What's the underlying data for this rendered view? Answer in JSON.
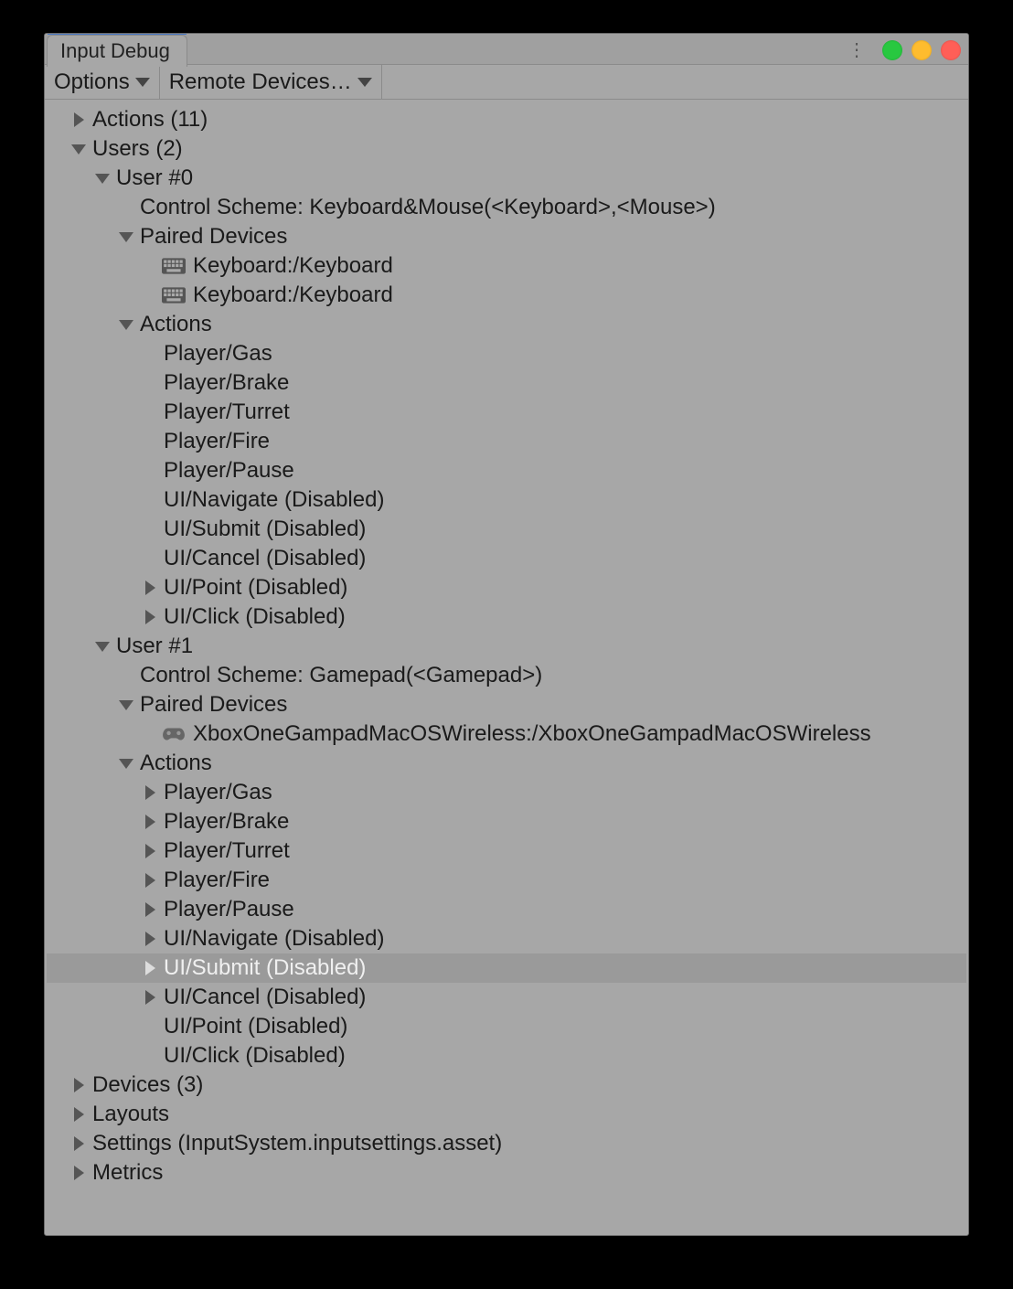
{
  "tab_title": "Input Debug",
  "toolbar": {
    "options_label": "Options",
    "remote_label": "Remote Devices…"
  },
  "tree": {
    "actions": {
      "label": "Actions (11)"
    },
    "users": {
      "label": "Users (2)",
      "user0": {
        "label": "User #0",
        "scheme": "Control Scheme: Keyboard&Mouse(<Keyboard>,<Mouse>)",
        "paired_label": "Paired Devices",
        "devices": [
          "Keyboard:/Keyboard",
          "Keyboard:/Keyboard"
        ],
        "actions_label": "Actions",
        "actions": [
          {
            "label": "Player/Gas",
            "fold": "none"
          },
          {
            "label": "Player/Brake",
            "fold": "none"
          },
          {
            "label": "Player/Turret",
            "fold": "none"
          },
          {
            "label": "Player/Fire",
            "fold": "none"
          },
          {
            "label": "Player/Pause",
            "fold": "none"
          },
          {
            "label": "UI/Navigate (Disabled)",
            "fold": "none"
          },
          {
            "label": "UI/Submit (Disabled)",
            "fold": "none"
          },
          {
            "label": "UI/Cancel (Disabled)",
            "fold": "none"
          },
          {
            "label": "UI/Point (Disabled)",
            "fold": "right"
          },
          {
            "label": "UI/Click (Disabled)",
            "fold": "right"
          }
        ]
      },
      "user1": {
        "label": "User #1",
        "scheme": "Control Scheme: Gamepad(<Gamepad>)",
        "paired_label": "Paired Devices",
        "devices": [
          "XboxOneGampadMacOSWireless:/XboxOneGampadMacOSWireless"
        ],
        "actions_label": "Actions",
        "actions": [
          {
            "label": "Player/Gas",
            "fold": "right"
          },
          {
            "label": "Player/Brake",
            "fold": "right"
          },
          {
            "label": "Player/Turret",
            "fold": "right"
          },
          {
            "label": "Player/Fire",
            "fold": "right"
          },
          {
            "label": "Player/Pause",
            "fold": "right"
          },
          {
            "label": "UI/Navigate (Disabled)",
            "fold": "right"
          },
          {
            "label": "UI/Submit (Disabled)",
            "fold": "right",
            "selected": true
          },
          {
            "label": "UI/Cancel (Disabled)",
            "fold": "right"
          },
          {
            "label": "UI/Point (Disabled)",
            "fold": "none"
          },
          {
            "label": "UI/Click (Disabled)",
            "fold": "none"
          }
        ]
      }
    },
    "devices": {
      "label": "Devices (3)"
    },
    "layouts": {
      "label": "Layouts"
    },
    "settings": {
      "label": "Settings (InputSystem.inputsettings.asset)"
    },
    "metrics": {
      "label": "Metrics"
    }
  }
}
